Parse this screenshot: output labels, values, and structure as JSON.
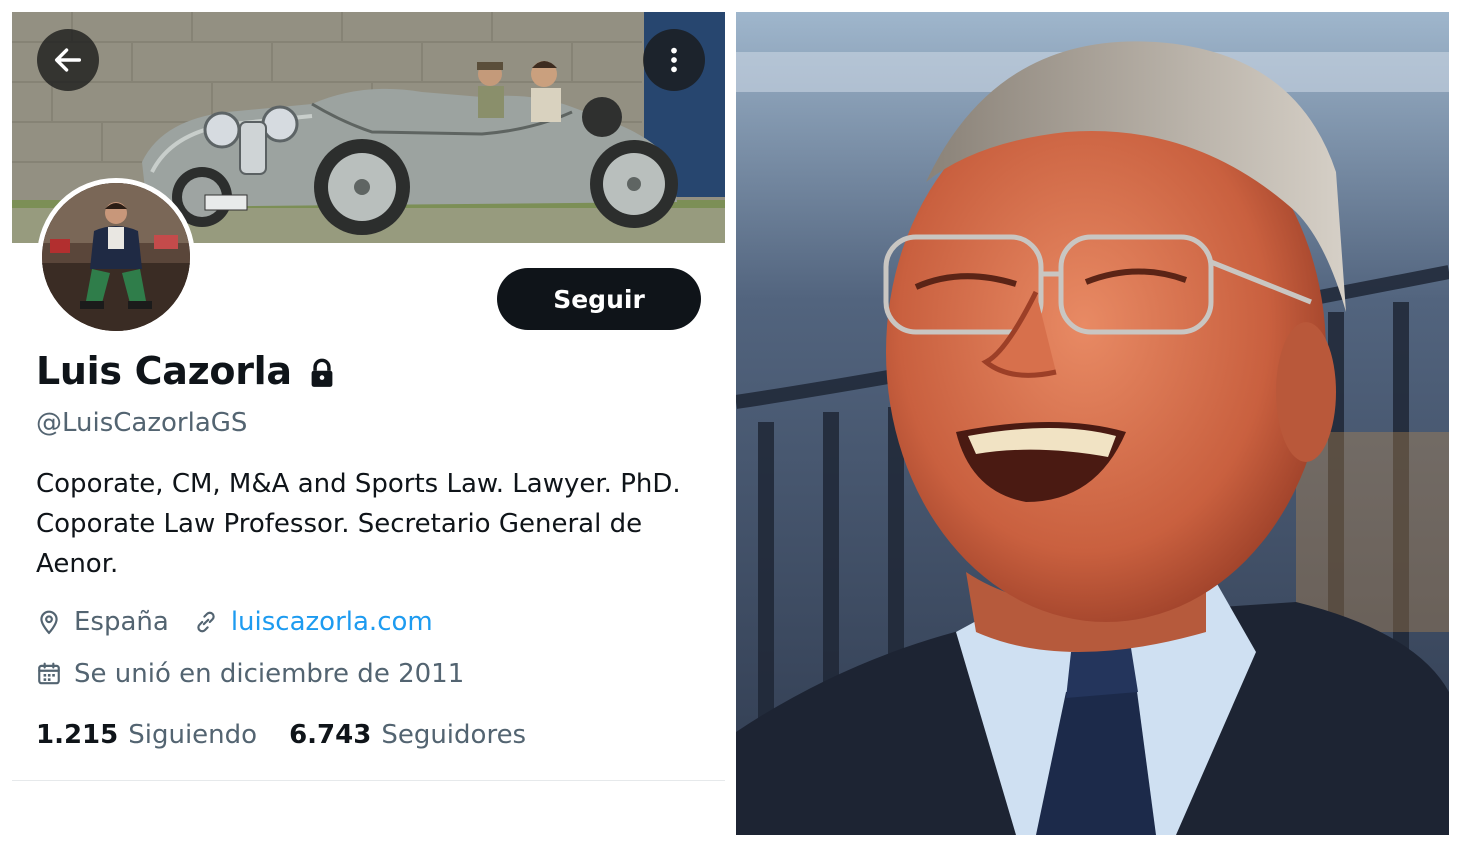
{
  "profile": {
    "display_name": "Luis Cazorla",
    "handle": "@LuisCazorlaGS",
    "bio": "Coporate, CM, M&A and Sports Law. Lawyer. PhD. Coporate Law Professor. Secretario General de Aenor.",
    "location": "España",
    "website": "luiscazorla.com",
    "joined": "Se unió en diciembre de 2011",
    "following_count": "1.215",
    "following_label": "Siguiendo",
    "followers_count": "6.743",
    "followers_label": "Seguidores",
    "follow_button_label": "Seguir",
    "is_protected": true
  },
  "icons": {
    "back": "arrow-left-icon",
    "more": "more-vertical-icon",
    "lock": "lock-icon",
    "location": "location-pin-icon",
    "link": "link-icon",
    "calendar": "calendar-icon"
  },
  "colors": {
    "text_primary": "#0f1419",
    "text_secondary": "#536471",
    "link": "#1d9bf0",
    "button_bg": "#0f1419",
    "button_text": "#ffffff",
    "divider": "#e6e9eb"
  }
}
